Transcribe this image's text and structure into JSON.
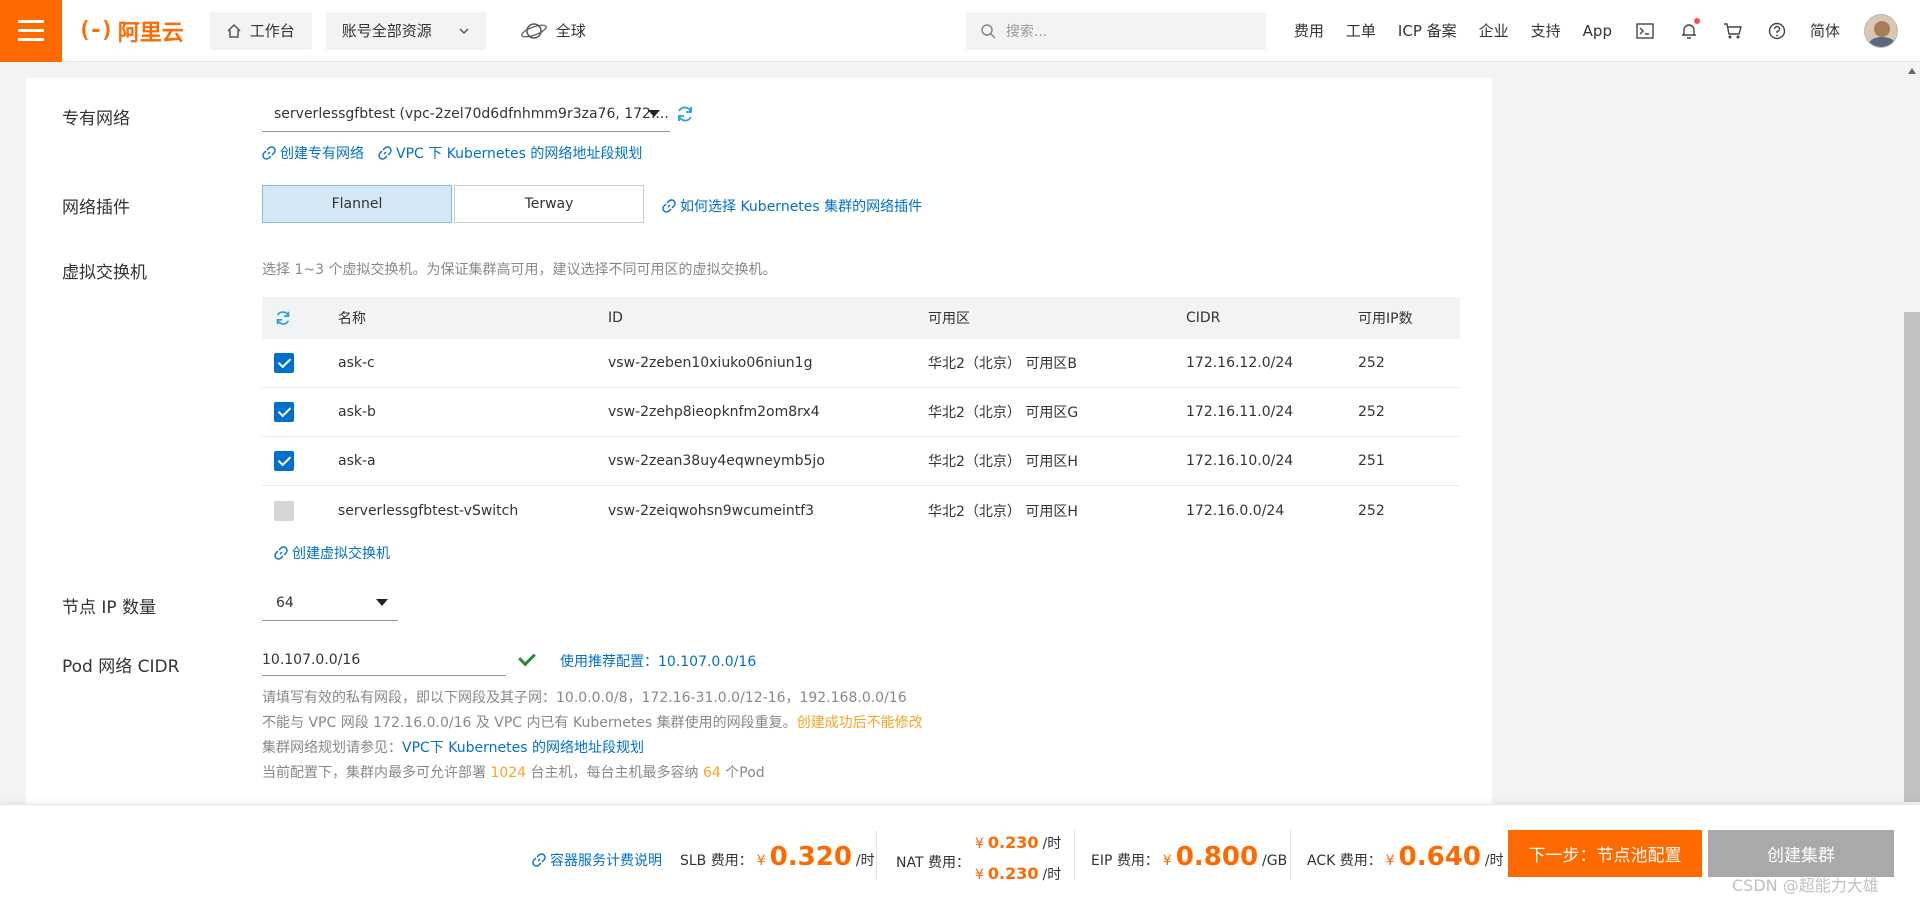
{
  "topbar": {
    "logo_text": "阿里云",
    "workbench": "工作台",
    "resources": "账号全部资源",
    "region": "全球",
    "search_placeholder": "搜索...",
    "links": [
      "费用",
      "工单",
      "ICP 备案",
      "企业",
      "支持",
      "App"
    ],
    "language": "简体",
    "brand_color": "#ff6a00"
  },
  "form": {
    "vpc_label": "专有网络",
    "vpc_value": "serverlessgfbtest (vpc-2zel70d6dfnhmm9r3za76, 172....",
    "vpc_links": [
      "创建专有网络",
      "VPC 下 Kubernetes 的网络地址段规划"
    ],
    "plugin_label": "网络插件",
    "plugin_options": [
      "Flannel",
      "Terway"
    ],
    "plugin_help": "如何选择 Kubernetes 集群的网络插件",
    "vswitch_label": "虚拟交换机",
    "vswitch_hint": "选择 1~3 个虚拟交换机。为保证集群高可用，建议选择不同可用区的虚拟交换机。",
    "table_headers": [
      "名称",
      "ID",
      "可用区",
      "CIDR",
      "可用IP数"
    ],
    "rows": [
      {
        "name": "ask-c",
        "id": "vsw-2zeben10xiuko06niun1g",
        "zone": "华北2（北京） 可用区B",
        "cidr": "172.16.12.0/24",
        "ips": "252",
        "checked": true
      },
      {
        "name": "ask-b",
        "id": "vsw-2zehp8ieopknfm2om8rx4",
        "zone": "华北2（北京） 可用区G",
        "cidr": "172.16.11.0/24",
        "ips": "252",
        "checked": true
      },
      {
        "name": "ask-a",
        "id": "vsw-2zean38uy4eqwneymb5jo",
        "zone": "华北2（北京） 可用区H",
        "cidr": "172.16.10.0/24",
        "ips": "251",
        "checked": true
      },
      {
        "name": "serverlessgfbtest-vSwitch",
        "id": "vsw-2zeiqwohsn9wcumeintf3",
        "zone": "华北2（北京） 可用区H",
        "cidr": "172.16.0.0/24",
        "ips": "252",
        "checked": false
      }
    ],
    "create_vswitch": "创建虚拟交换机",
    "node_ip_label": "节点 IP 数量",
    "node_ip_value": "64",
    "pod_cidr_label": "Pod 网络 CIDR",
    "pod_cidr_value": "10.107.0.0/16",
    "recommend": "使用推荐配置：10.107.0.0/16",
    "note1": "请填写有效的私有网段，即以下网段及其子网：10.0.0.0/8，172.16-31.0.0/12-16，192.168.0.0/16",
    "note2a": "不能与 VPC 网段 172.16.0.0/16 及 VPC 内已有 Kubernetes 集群使用的网段重复。",
    "note2b": "创建成功后不能修改",
    "note3a": "集群网络规划请参见：",
    "note3b": "VPC下 Kubernetes 的网络地址段规划",
    "note4a": "当前配置下，集群内最多可允许部署 ",
    "note4b": "1024",
    "note4c": " 台主机，每台主机最多容纳 ",
    "note4d": "64",
    "note4e": " 个Pod"
  },
  "footer": {
    "pricing_link": "容器服务计费说明",
    "slb_label": "SLB 费用：",
    "slb_value": "0.320",
    "slb_unit": "/时",
    "nat_label": "NAT 费用：",
    "nat_value1": "0.230",
    "nat_value2": "0.230",
    "nat_unit": "/时",
    "eip_label": "EIP 费用：",
    "eip_value": "0.800",
    "eip_unit": "/GB",
    "ack_label": "ACK 费用：",
    "ack_value": "0.640",
    "ack_unit": "/时",
    "currency": "¥",
    "next_button": "下一步：节点池配置",
    "create_button": "创建集群",
    "watermark": "CSDN @超能力大雄"
  }
}
